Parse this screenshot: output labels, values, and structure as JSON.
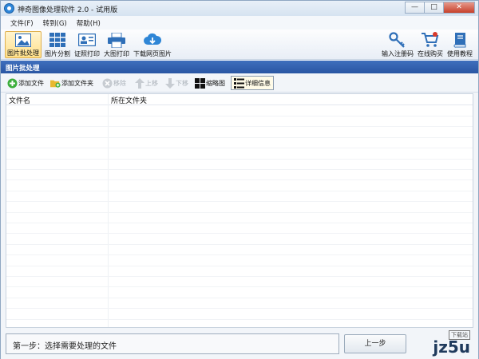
{
  "window": {
    "title": "神奇图像处理软件 2.0 - 试用版",
    "controls": {
      "minimize": "—",
      "maximize": "□",
      "close": "✕"
    }
  },
  "menu": [
    "文件(F)",
    "转到(G)",
    "帮助(H)"
  ],
  "toolbar": {
    "left": [
      {
        "label": "图片批处理",
        "icon": "image-icon",
        "active": true
      },
      {
        "label": "图片分割",
        "icon": "grid-icon",
        "active": false
      },
      {
        "label": "证照打印",
        "icon": "id-card-icon",
        "active": false
      },
      {
        "label": "大图打印",
        "icon": "printer-icon",
        "active": false
      },
      {
        "label": "下载网页图片",
        "icon": "cloud-download-icon",
        "active": false
      }
    ],
    "right": [
      {
        "label": "输入注册码",
        "icon": "key-icon"
      },
      {
        "label": "在线购买",
        "icon": "cart-icon"
      },
      {
        "label": "使用教程",
        "icon": "book-icon"
      }
    ]
  },
  "section_title": "图片批处理",
  "subtoolbar": {
    "add_file": "添加文件",
    "add_folder": "添加文件夹",
    "remove": "移除",
    "move_up": "上移",
    "move_down": "下移",
    "thumbnail": "缩略图",
    "details": "详细信息"
  },
  "table": {
    "columns": [
      "文件名",
      "所在文件夹"
    ],
    "rows": []
  },
  "status": {
    "step_text": "第一步：选择需要处理的文件",
    "prev_button": "上一步"
  },
  "watermark": {
    "text": "jz5u",
    "sub": "下载站"
  },
  "colors": {
    "section_bar": "#2f5fae",
    "active_tool": "#ffe08a",
    "close_button": "#c7402b"
  }
}
